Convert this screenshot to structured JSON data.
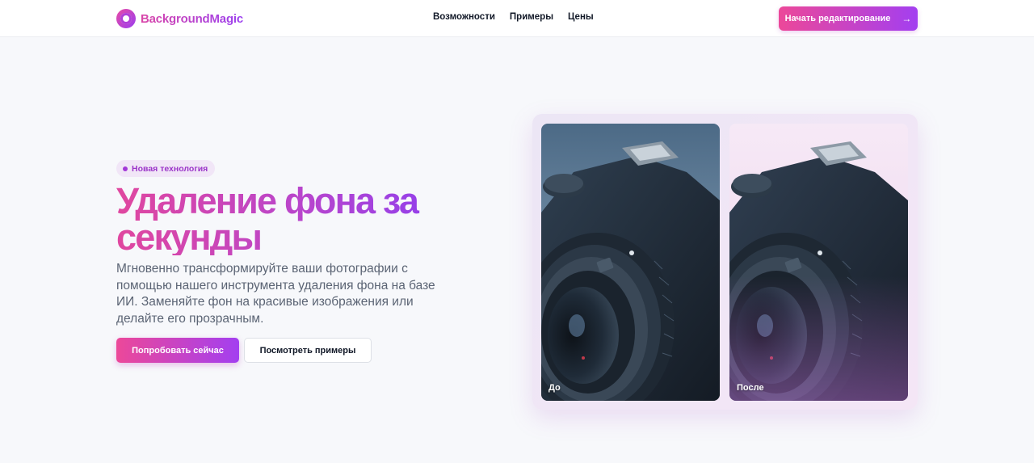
{
  "brand": {
    "name": "BackgroundMagic"
  },
  "nav": {
    "items": [
      {
        "label": "Возможности"
      },
      {
        "label": "Примеры"
      },
      {
        "label": "Цены"
      }
    ]
  },
  "header_cta": {
    "label": "Начать редактирование",
    "icon": "arrow-right-icon"
  },
  "hero": {
    "badge": "Новая технология",
    "title": "Удаление фона за секунды",
    "subtitle": "Мгновенно трансформируйте ваши фотографии с помощью нашего инструмента удаления фона на базе ИИ. Заменяйте фон на красивые изображения или делайте его прозрачным.",
    "primary_button": "Попробовать сейчас",
    "secondary_button": "Посмотреть примеры"
  },
  "compare": {
    "before_label": "До",
    "after_label": "После"
  },
  "colors": {
    "accent_start": "#ec4899",
    "accent_end": "#a33ff0",
    "text_dark": "#111827",
    "text_muted": "#5b6474"
  }
}
